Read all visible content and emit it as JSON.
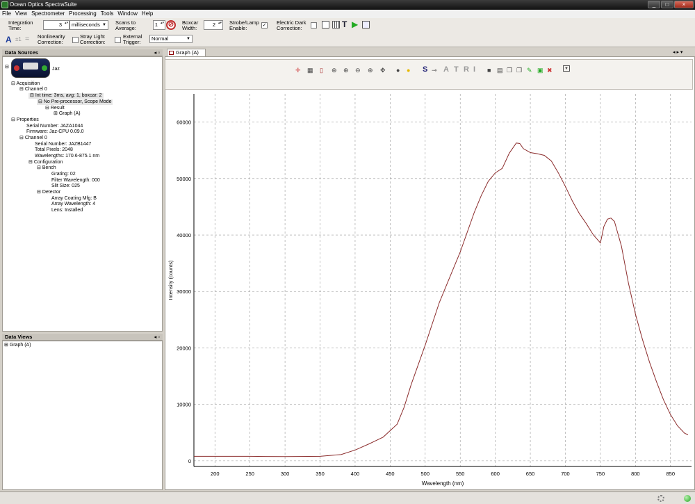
{
  "window": {
    "title": "Ocean Optics SpectraSuite"
  },
  "menu": [
    "File",
    "View",
    "Spectrometer",
    "Processing",
    "Tools",
    "Window",
    "Help"
  ],
  "toolbar": {
    "integration_time_label": "Integration\nTime:",
    "integration_time_value": "3",
    "integration_unit": "milliseconds",
    "scans_label": "Scans to\nAverage:",
    "scans_value": "1",
    "boxcar_label": "Boxcar\nWidth:",
    "boxcar_value": "2",
    "strobe_label": "Strobe/Lamp\nEnable:",
    "strobe_checked": "✓",
    "dark_label": "Electric Dark\nCorrection:",
    "nonlinearity_label": "Nonlinearity\nCorrection:",
    "stray_label": "Stray Light\nCorrection:",
    "trigger_label": "External\nTrigger:",
    "trigger_value": "Normal"
  },
  "data_sources": {
    "header": "Data Sources",
    "device": "Jaz",
    "tree": [
      "Acquisition",
      "Channel 0",
      "Int time: 3ms, avg: 1, boxcar: 2",
      "No Pre-processor, Scope Mode",
      "Result",
      "Graph (A)",
      "Properties",
      "Serial Number: JAZA1044",
      "Firmware: Jaz-CPU 0.09.0",
      "Channel 0",
      "Serial Number: JAZB1447",
      "Total Pixels: 2048",
      "Wavelengths: 170.6-875.1 nm",
      "Configuration",
      "Bench",
      "Grating: 02",
      "Filter Wavelength: 000",
      "Slit Size: 025",
      "Detector",
      "Array Coating Mfg: B",
      "Array Wavelength: 4",
      "Lens: Installed"
    ]
  },
  "data_views": {
    "header": "Data Views",
    "items": [
      "Graph (A)"
    ]
  },
  "graph_tab": {
    "label": "Graph (A)"
  },
  "graph_toolbar_letters": [
    "S",
    "A",
    "T",
    "R",
    "I"
  ],
  "chart_data": {
    "type": "line",
    "title": "",
    "xlabel": "Wavelength (nm)",
    "ylabel": "Intensity (counts)",
    "xlim": [
      170,
      880
    ],
    "ylim": [
      -1000,
      65000
    ],
    "xticks": [
      200,
      250,
      300,
      350,
      400,
      450,
      500,
      550,
      600,
      650,
      700,
      750,
      800,
      850
    ],
    "yticks": [
      0,
      10000,
      20000,
      30000,
      40000,
      50000,
      60000
    ],
    "grid": true,
    "color": "#8b2c2c",
    "series": [
      {
        "x": [
          170,
          200,
          250,
          300,
          350,
          380,
          400,
          420,
          440,
          460,
          470,
          480,
          490,
          500,
          520,
          540,
          550,
          560,
          570,
          580,
          590,
          600,
          610,
          620,
          630,
          635,
          640,
          650,
          660,
          670,
          680,
          690,
          700,
          710,
          720,
          730,
          740,
          750,
          755,
          760,
          765,
          770,
          780,
          790,
          800,
          810,
          820,
          830,
          840,
          850,
          860,
          870,
          875
        ],
        "y": [
          800,
          800,
          800,
          750,
          800,
          1100,
          1900,
          3000,
          4200,
          6500,
          9500,
          13500,
          17000,
          20500,
          28000,
          34000,
          37000,
          40500,
          44000,
          47000,
          49500,
          51000,
          51800,
          54500,
          56300,
          56200,
          55300,
          54600,
          54400,
          54100,
          53100,
          51000,
          48600,
          46000,
          43800,
          42000,
          40000,
          38600,
          41500,
          42800,
          43000,
          42400,
          38000,
          31500,
          26000,
          21500,
          17500,
          14000,
          10800,
          8200,
          6200,
          4900,
          4600
        ]
      }
    ]
  }
}
